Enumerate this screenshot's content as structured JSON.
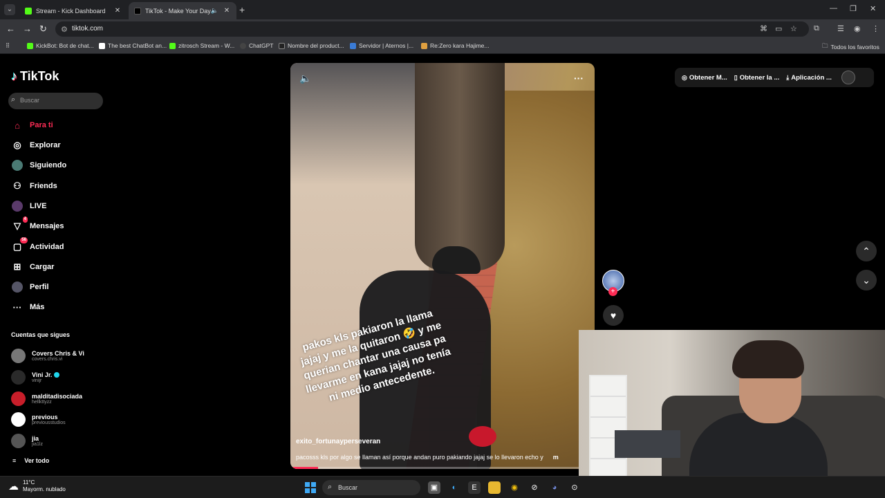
{
  "browser": {
    "tabs": [
      {
        "title": "Stream - Kick Dashboard",
        "active": false,
        "favicon_color": "#53fc18"
      },
      {
        "title": "TikTok - Make Your Day",
        "active": true,
        "favicon_color": "#000000"
      }
    ],
    "url": "tiktok.com",
    "bookmarks": [
      {
        "label": "KickBot: Bot de chat...",
        "color": "#53fc18"
      },
      {
        "label": "The best ChatBot an...",
        "color": "#ffffff"
      },
      {
        "label": "zitrosch Stream - W...",
        "color": "#53fc18"
      },
      {
        "label": "ChatGPT",
        "color": "#444444"
      },
      {
        "label": "Nombre del product...",
        "color": "#222222"
      },
      {
        "label": "Servidor | Aternos |...",
        "color": "#3a7bd5"
      },
      {
        "label": "Re:Zero kara Hajime...",
        "color": "#e0a040"
      }
    ],
    "all_favorites": "Todos los favoritos"
  },
  "tiktok": {
    "logo": "TikTok",
    "search_placeholder": "Buscar",
    "nav": [
      {
        "label": "Para ti",
        "icon": "home-icon",
        "active": true
      },
      {
        "label": "Explorar",
        "icon": "compass-icon",
        "active": false
      },
      {
        "label": "Siguiendo",
        "icon": "following-icon",
        "active": false
      },
      {
        "label": "Friends",
        "icon": "friends-icon",
        "active": false
      },
      {
        "label": "LIVE",
        "icon": "live-icon",
        "active": false
      },
      {
        "label": "Mensajes",
        "icon": "messages-icon",
        "active": false,
        "badge": "4"
      },
      {
        "label": "Actividad",
        "icon": "activity-icon",
        "active": false,
        "badge": "56"
      },
      {
        "label": "Cargar",
        "icon": "upload-icon",
        "active": false
      },
      {
        "label": "Perfil",
        "icon": "profile-icon",
        "active": false
      },
      {
        "label": "Más",
        "icon": "more-icon",
        "active": false
      }
    ],
    "following_header": "Cuentas que sigues",
    "following": [
      {
        "name": "Covers Chris & Vi",
        "handle": "covers.chris.vi",
        "verified": false
      },
      {
        "name": "Vini Jr.",
        "handle": "vinijr",
        "verified": true
      },
      {
        "name": "malditadisociada",
        "handle": "hellkttyzz",
        "verified": false
      },
      {
        "name": "previous",
        "handle": "previousstudios",
        "verified": false
      },
      {
        "name": "jia",
        "handle": "jia1lz",
        "verified": false
      }
    ],
    "see_all": "Ver todo",
    "video": {
      "overlay_text": "pakos kls pakiaron la llama jajaj y me la quitaron 🤣 y me querian chantar una causa pa llevarme en kana jajaj no tenía ni medio antecedente.",
      "username": "exito_fortunayperseveran",
      "description": "pacosss kls por algo se llaman así porque andan puro pakiando jajaj se lo llevaron echo y",
      "more_label": "m",
      "progress": 0.09
    },
    "top_right": {
      "items": [
        {
          "label": "Obtener M...",
          "icon": "coin-icon"
        },
        {
          "label": "Obtener la ...",
          "icon": "phone-icon"
        },
        {
          "label": "Aplicación ...",
          "icon": "download-icon"
        }
      ]
    }
  },
  "taskbar": {
    "temperature": "11°C",
    "weather": "Mayorm. nublado",
    "search_placeholder": "Buscar"
  }
}
